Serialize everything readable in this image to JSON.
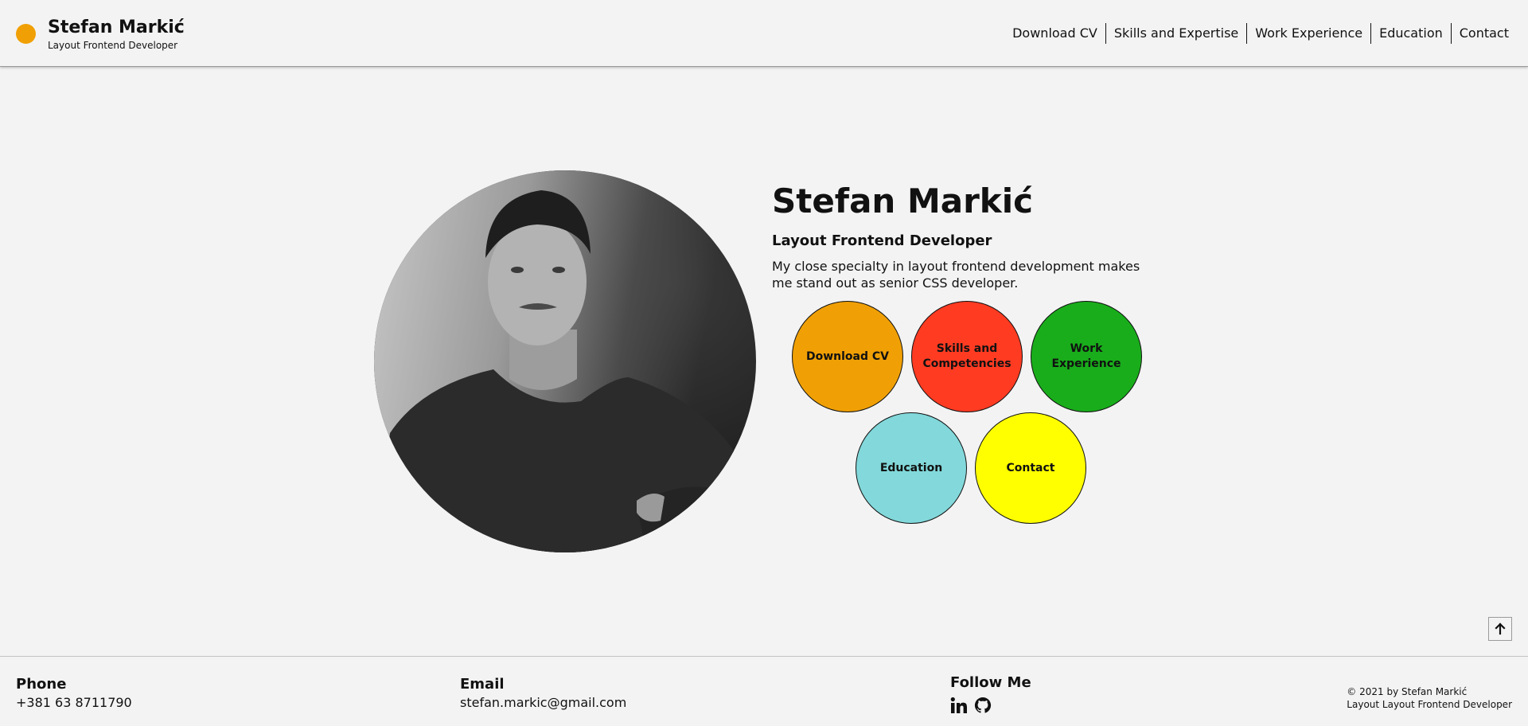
{
  "header": {
    "name": "Stefan Markić",
    "role": "Layout Frontend Developer",
    "nav": [
      "Download CV",
      "Skills and Expertise",
      "Work Experience",
      "Education",
      "Contact"
    ]
  },
  "hero": {
    "name": "Stefan Markić",
    "role": "Layout Frontend Developer",
    "description": "My close specialty in layout frontend development makes me stand out as senior CSS developer.",
    "buttons": {
      "download": "Download CV",
      "skills": "Skills and Competencies",
      "work": "Work Experience",
      "education": "Education",
      "contact": "Contact"
    }
  },
  "footer": {
    "phone_title": "Phone",
    "phone": "+381 63 8711790",
    "email_title": "Email",
    "email": "stefan.markic@gmail.com",
    "follow_title": "Follow Me",
    "social_icons": [
      "linkedin-icon",
      "github-icon"
    ],
    "copyright": "© 2021 by Stefan Markić",
    "tagline": "Layout Layout Frontend Developer"
  },
  "back_to_top_icon": "arrow-up-icon",
  "colors": {
    "brand": "#f0a005",
    "download": "#f0a005",
    "skills": "#ff3b22",
    "work": "#19ad1b",
    "education": "#82d8da",
    "contact": "#ffff00"
  }
}
